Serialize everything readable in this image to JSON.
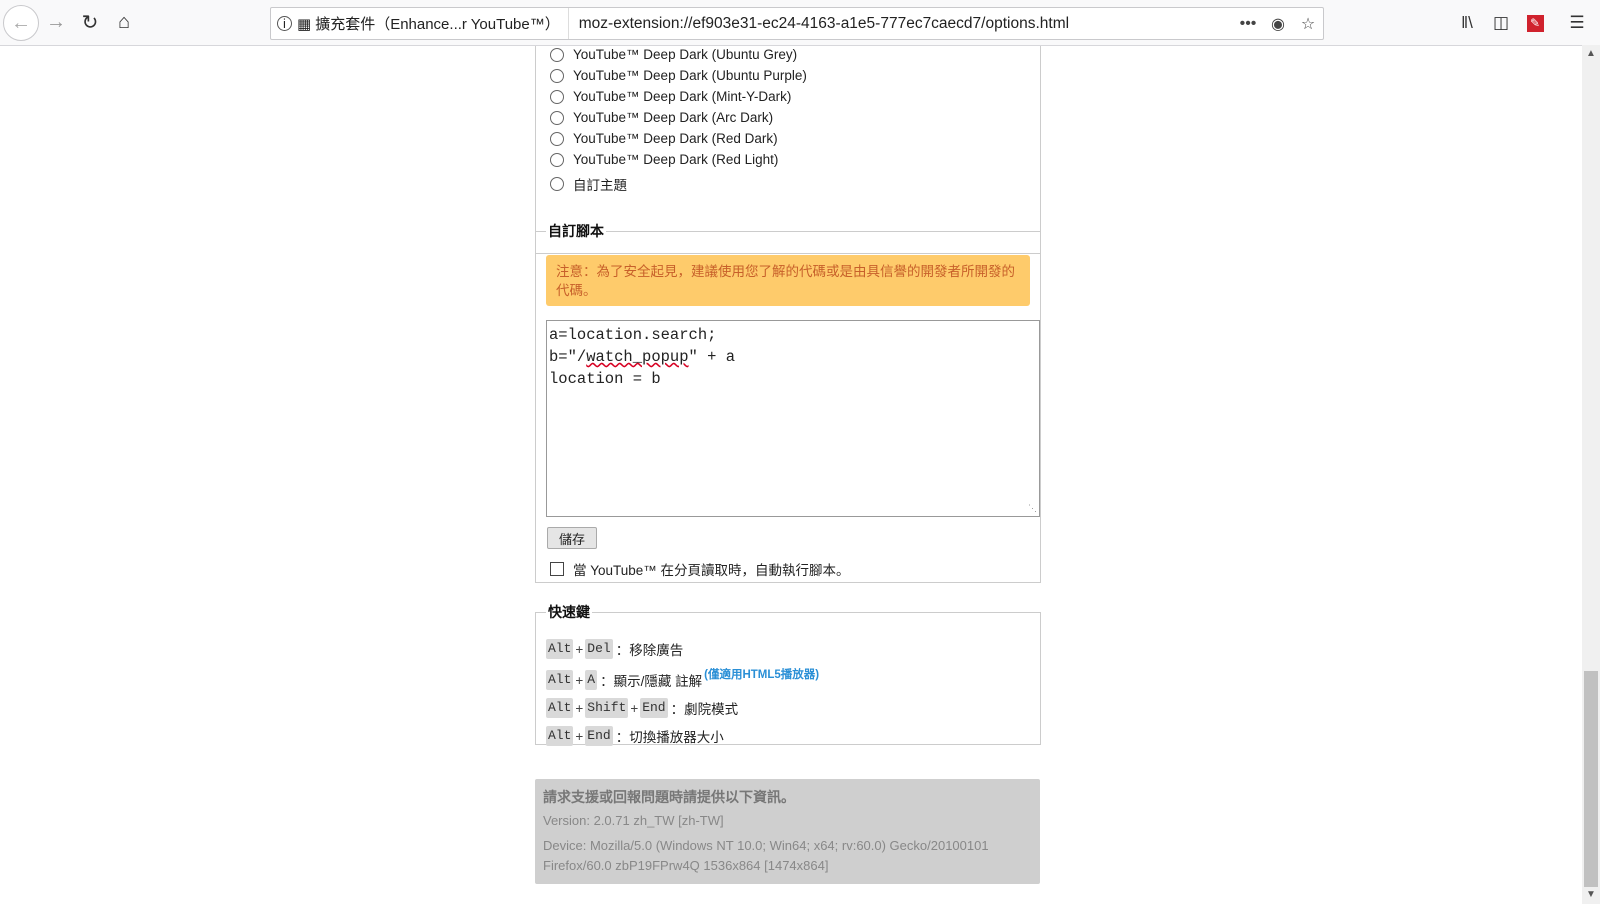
{
  "browser": {
    "identity_label": "擴充套件（Enhance...r YouTube™）",
    "url": "moz-extension://ef903e31-ec24-4163-a1e5-777ec7caecd7/options.html",
    "icons": [
      "back-icon",
      "forward-icon",
      "reload-icon",
      "home-icon",
      "info-icon",
      "puzzle-icon",
      "more-icon",
      "pocket-icon",
      "star-icon",
      "library-icon",
      "sidebar-icon",
      "extension-icon",
      "menu-icon"
    ]
  },
  "themes": {
    "options": [
      "YouTube™ Deep Dark (Ubuntu Grey)",
      "YouTube™ Deep Dark (Ubuntu Purple)",
      "YouTube™ Deep Dark (Mint-Y-Dark)",
      "YouTube™ Deep Dark (Arc Dark)",
      "YouTube™ Deep Dark (Red Dark)",
      "YouTube™ Deep Dark (Red Light)",
      "自訂主題"
    ]
  },
  "script": {
    "legend": "自訂腳本",
    "warning": "注意：為了安全起見，建議使用您了解的代碼或是由具信譽的開發者所開發的代碼。",
    "code_lines": [
      "a=location.search;",
      "b=\"/watch_popup\" + a",
      "location = b"
    ],
    "save_label": "儲存",
    "autorun_label": "當 YouTube™ 在分頁讀取時，自動執行腳本。"
  },
  "hotkeys": {
    "legend": "快速鍵",
    "items": [
      {
        "keys": [
          "Alt",
          "Del"
        ],
        "desc": "：移除廣告",
        "note": ""
      },
      {
        "keys": [
          "Alt",
          "A"
        ],
        "desc": "：顯示/隱藏 註解",
        "note": "(僅適用HTML5播放器)"
      },
      {
        "keys": [
          "Alt",
          "Shift",
          "End"
        ],
        "desc": "：劇院模式",
        "note": ""
      },
      {
        "keys": [
          "Alt",
          "End"
        ],
        "desc": "：切換播放器大小",
        "note": ""
      }
    ]
  },
  "support": {
    "title": "請求支援或回報問題時請提供以下資訊。",
    "version": "Version: 2.0.71 zh_TW [zh-TW]",
    "device_line1": "Device: Mozilla/5.0 (Windows NT 10.0; Win64; x64; rv:60.0) Gecko/20100101",
    "device_line2": "Firefox/60.0 zbP19FPrw4Q 1536x864 [1474x864]"
  }
}
